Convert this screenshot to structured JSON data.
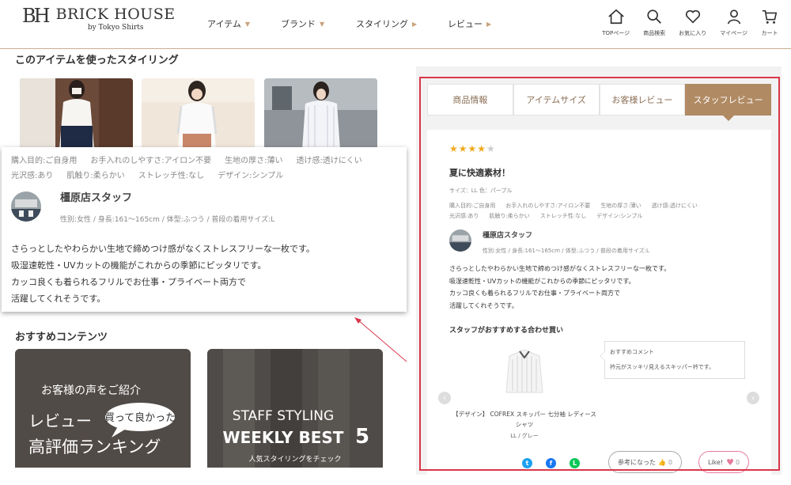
{
  "brand": {
    "mark": "BH",
    "title": "BRICK HOUSE",
    "subtitle": "by Tokyo Shirts"
  },
  "nav": [
    {
      "label": "アイテム",
      "arrow": "▼"
    },
    {
      "label": "ブランド",
      "arrow": "▼"
    },
    {
      "label": "スタイリング",
      "arrow": "▶"
    },
    {
      "label": "レビュー",
      "arrow": "▶"
    }
  ],
  "header_icons": [
    {
      "icon": "home-icon",
      "label": "TOPページ"
    },
    {
      "icon": "search-icon",
      "label": "商品検索"
    },
    {
      "icon": "heart-icon",
      "label": "お気に入り"
    },
    {
      "icon": "person-icon",
      "label": "マイページ"
    },
    {
      "icon": "cart-icon",
      "label": "カート"
    }
  ],
  "styling_section": {
    "title": "このアイテムを使ったスタイリング"
  },
  "zoom": {
    "attrs_line1": [
      "購入目的:ご自身用",
      "お手入れのしやすさ:アイロン不要",
      "生地の厚さ:薄い",
      "透け感:透けにくい"
    ],
    "attrs_line2": [
      "光沢感:あり",
      "肌触り:柔らかい",
      "ストレッチ性:なし",
      "デザイン:シンプル"
    ],
    "staff_name": "橿原店スタッフ",
    "staff_meta": "性別:女性 / 身長:161～165cm / 体型:ふつう / 普段の着用サイズ:L",
    "review_lines": [
      "さらっとしたやわらかい生地で締めつけ感がなくストレスフリーな一枚です。",
      "吸湿速乾性・UVカットの機能がこれからの季節にピッタリです。",
      "カッコ良くも着られるフリルでお仕事・プライベート両方で",
      "活躍してくれそうです。"
    ]
  },
  "recommend": {
    "title": "おすすめコンテンツ",
    "card1": {
      "line1": "お客様の声をご紹介",
      "line2": "レビュー",
      "bubble": "買って良かった",
      "line3": "高評価ランキング"
    },
    "card2": {
      "line1": "STAFF STYLING",
      "line2": "WEEKLY BEST",
      "number": "5",
      "line3": "人気スタイリングをチェック"
    }
  },
  "tabs": [
    {
      "label": "商品情報",
      "active": false
    },
    {
      "label": "アイテムサイズ",
      "active": false
    },
    {
      "label": "お客様レビュー",
      "active": false
    },
    {
      "label": "スタッフレビュー",
      "active": true
    }
  ],
  "review": {
    "rating": 4,
    "rating_max": 5,
    "star_on": "★★★★",
    "star_off": "★",
    "title": "夏に快適素材！",
    "size_color": "サイズ：LL 色：パープル",
    "attrs_line1": [
      "購入目的:ご自身用",
      "お手入れのしやすさ:アイロン不要",
      "生地の厚さ:薄い",
      "透け感:透けにくい"
    ],
    "attrs_line2": [
      "光沢感:あり",
      "肌触り:柔らかい",
      "ストレッチ性:なし",
      "デザイン:シンプル"
    ],
    "staff_name": "橿原店スタッフ",
    "staff_meta": "性別:女性 / 身長:161～165cm / 体型:ふつう / 普段の着用サイズ:L",
    "text_lines": [
      "さらっとしたやわらかい生地で締めつけ感がなくストレスフリーな一枚です。",
      "吸湿速乾性・UVカットの機能がこれからの季節にピッタリです。",
      "カッコ良くも着られるフリルでお仕事・プライベート両方で",
      "活躍してくれそうです。"
    ],
    "coordinate_title": "スタッフがおすすめする合わせ買い",
    "product_name_line1": "【デザイン】 COFREX スキッパー 七分袖 レディース",
    "product_name_line2": "シャツ",
    "product_variant": "LL / グレー",
    "comment_head": "おすすめコメント",
    "comment_body": "衿元がスッキリ見えるスキッパー衿です。",
    "helpful_label": "参考になった",
    "helpful_count": "0",
    "like_label": "Like!",
    "like_count": "0"
  },
  "colors": {
    "accent": "#b08a63",
    "tab_text": "#8b6f55",
    "highlight": "#d9374b",
    "star": "#f0a91c"
  }
}
